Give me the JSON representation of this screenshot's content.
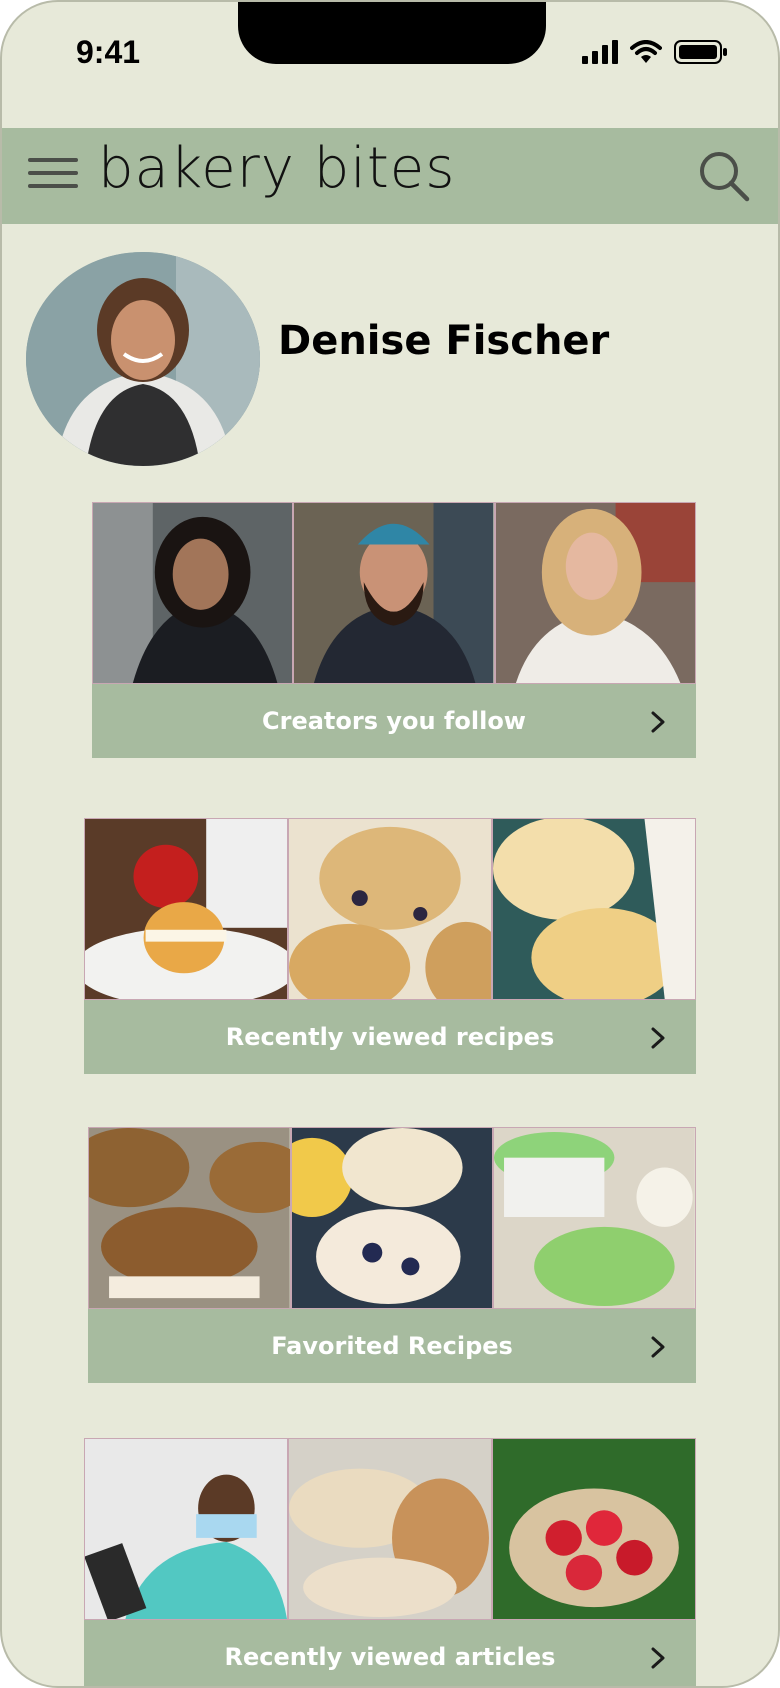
{
  "status_bar": {
    "time": "9:41"
  },
  "header": {
    "title": "bakery bites",
    "menu_icon": "hamburger-menu-icon",
    "search_icon": "search-icon"
  },
  "profile": {
    "name": "Denise Fischer"
  },
  "sections": [
    {
      "label": "Creators you follow",
      "thumbs": [
        "creator-woman-dark-hair",
        "creator-bearded-man",
        "creator-blonde-woman"
      ]
    },
    {
      "label": "Recently viewed recipes",
      "thumbs": [
        "cream-puff",
        "blueberry-scone",
        "sugar-cookies"
      ]
    },
    {
      "label": "Favorited Recipes",
      "thumbs": [
        "oatmeal-cream-pie",
        "lemon-blueberry-cookies",
        "green-cookies"
      ]
    },
    {
      "label": "Recently viewed articles",
      "thumbs": [
        "nurse-tablet",
        "sourdough-bread",
        "strawberries"
      ]
    }
  ],
  "colors": {
    "background": "#e7e9d9",
    "accent": "#a7bb9f",
    "text": "#000000",
    "label": "#ffffff"
  }
}
